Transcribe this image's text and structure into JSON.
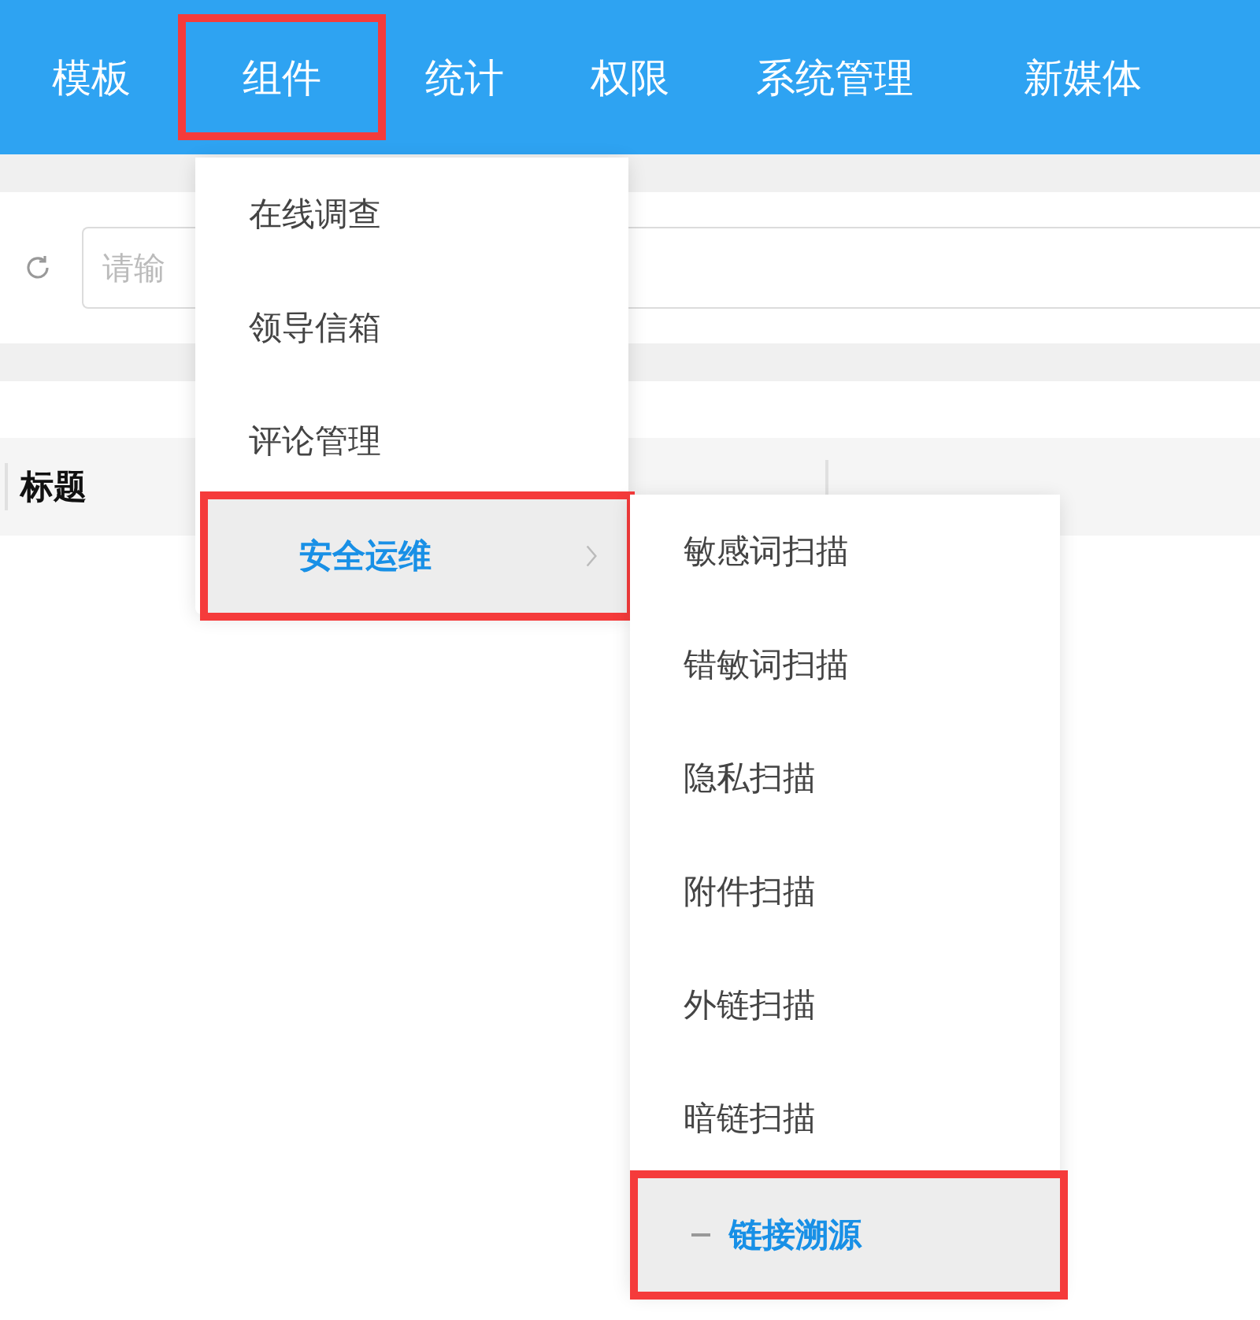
{
  "nav": {
    "items": [
      {
        "label": "模板",
        "highlighted": false
      },
      {
        "label": "组件",
        "highlighted": true
      },
      {
        "label": "统计",
        "highlighted": false
      },
      {
        "label": "权限",
        "highlighted": false
      },
      {
        "label": "系统管理",
        "highlighted": false
      },
      {
        "label": "新媒体",
        "highlighted": false
      }
    ]
  },
  "toolbar": {
    "search": {
      "placeholder": "请输"
    }
  },
  "table": {
    "columns": [
      "标题"
    ]
  },
  "menu": {
    "items": [
      {
        "label": "在线调查",
        "selected": false,
        "highlighted": false
      },
      {
        "label": "领导信箱",
        "selected": false,
        "highlighted": false
      },
      {
        "label": "评论管理",
        "selected": false,
        "highlighted": false
      },
      {
        "label": "安全运维",
        "selected": true,
        "highlighted": true,
        "children": [
          {
            "label": "敏感词扫描",
            "selected": false,
            "highlighted": false
          },
          {
            "label": "错敏词扫描",
            "selected": false,
            "highlighted": false
          },
          {
            "label": "隐私扫描",
            "selected": false,
            "highlighted": false
          },
          {
            "label": "附件扫描",
            "selected": false,
            "highlighted": false
          },
          {
            "label": "外链扫描",
            "selected": false,
            "highlighted": false
          },
          {
            "label": "暗链扫描",
            "selected": false,
            "highlighted": false
          },
          {
            "label": "链接溯源",
            "selected": true,
            "highlighted": true
          }
        ]
      }
    ]
  }
}
